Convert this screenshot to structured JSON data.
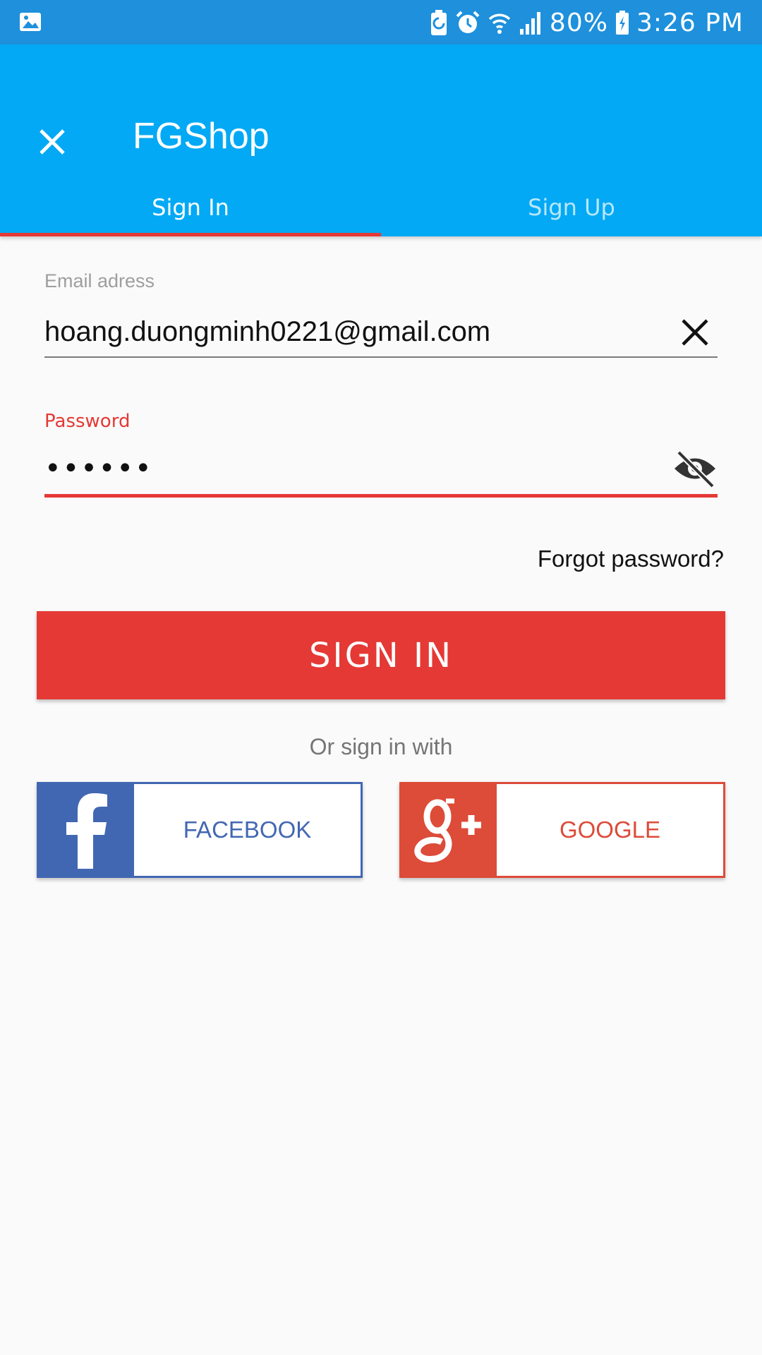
{
  "status_bar": {
    "battery": "80%",
    "time": "3:26 PM"
  },
  "app_bar": {
    "title": "FGShop"
  },
  "tabs": [
    {
      "label": "Sign In",
      "active": true
    },
    {
      "label": "Sign Up",
      "active": false
    }
  ],
  "form": {
    "email_label": "Email adress",
    "email_value": "hoang.duongminh0221@gmail.com",
    "password_label": "Password",
    "password_value": "••••••",
    "forgot_password": "Forgot password?",
    "sign_in_button": "SIGN IN",
    "or_text": "Or sign in with"
  },
  "social": {
    "facebook_label": "FACEBOOK",
    "google_label": "GOOGLE"
  },
  "colors": {
    "status_bar": "#1E90DC",
    "app_bar": "#03A9F4",
    "accent": "#E53935",
    "facebook": "#4267B2",
    "google": "#DD4B39",
    "background": "#FAFAFA"
  },
  "icons": {
    "status_left": "image-icon",
    "status_right": [
      "battery-saver-icon",
      "alarm-icon",
      "wifi-icon",
      "signal-icon",
      "charging-battery-icon"
    ],
    "app_bar": "close-icon",
    "email_field": "clear-icon",
    "password_field": "visibility-off-icon",
    "facebook": "facebook-logo-icon",
    "google": "google-plus-logo-icon"
  }
}
